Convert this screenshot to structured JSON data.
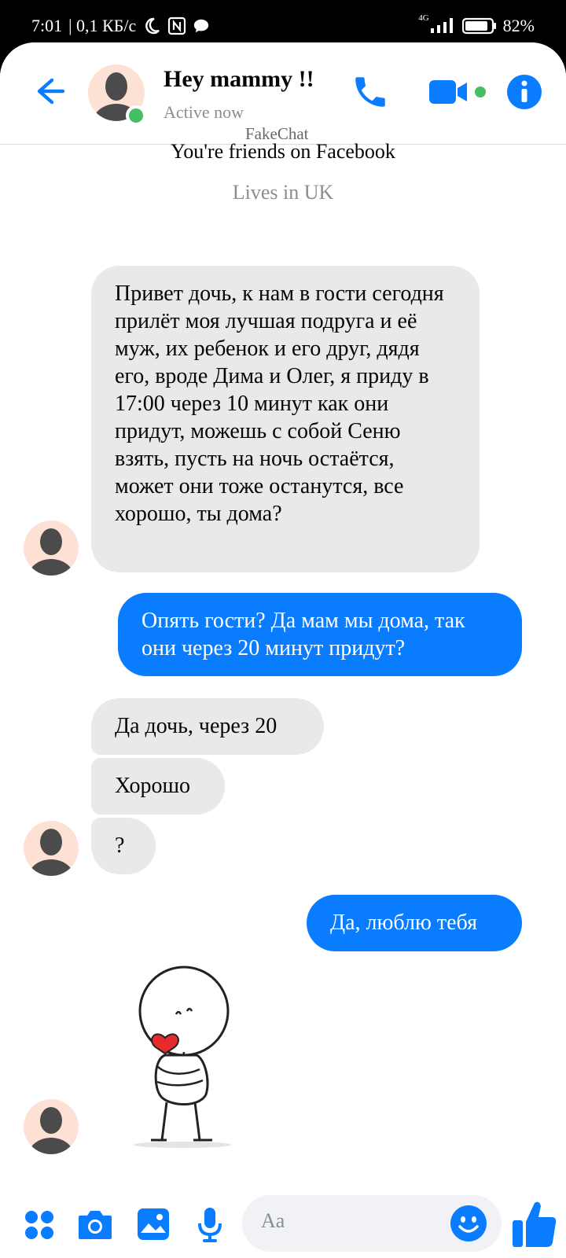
{
  "status_bar": {
    "time": "7:01",
    "speed": "| 0,1 КБ/с",
    "network": "4G",
    "battery": "82%"
  },
  "header": {
    "contact_name": "Hey mammy !!",
    "presence": "Active now",
    "watermark": "FakeChat"
  },
  "intro": {
    "friends_text": "You're friends on Facebook",
    "lives_text": "Lives in UK"
  },
  "messages": [
    {
      "from": "them",
      "text": "Привет дочь, к нам в гости сегодня прилёт моя лучшая подруга и её муж, их ребенок и его друг, дядя его, вроде Дима и Олег, я приду в 17:00 через 10 минут как они придут, можешь с собой Сеню взять, пусть на ночь остаётся, может они тоже останутся, все хорошо, ты дома?"
    },
    {
      "from": "me",
      "text": "Опять гости? Да мам мы дома, так они через 20 минут придут?"
    },
    {
      "from": "them",
      "text": "Да дочь, через 20"
    },
    {
      "from": "them",
      "text": "Хорошо"
    },
    {
      "from": "them",
      "text": "?"
    },
    {
      "from": "me",
      "text": "Да, люблю тебя"
    }
  ],
  "composer": {
    "placeholder": "Aa"
  },
  "colors": {
    "accent": "#0a7cff",
    "incoming_bubble": "#e9e9eb",
    "online": "#45bd62"
  },
  "icons": [
    "back-arrow-icon",
    "phone-icon",
    "video-camera-icon",
    "info-icon",
    "menu-grid-icon",
    "camera-icon",
    "gallery-icon",
    "microphone-icon",
    "emoji-icon",
    "thumbs-up-icon"
  ]
}
